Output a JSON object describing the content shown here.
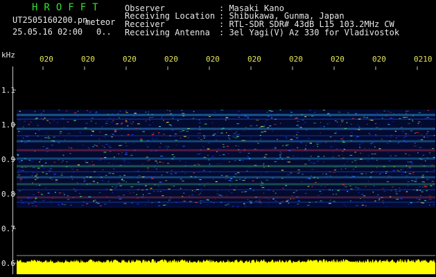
{
  "header": {
    "brand": "HROFFT",
    "filename": "UT2505160200.pn",
    "mode": "meteor",
    "datetime": "25.05.16 02:00",
    "extra": "0.."
  },
  "meta": {
    "observer_label": "Observer",
    "observer_value": ": Masaki Kano",
    "location_label": "Receiving Location",
    "location_value": ": Shibukawa, Gunma, Japan",
    "receiver_label": "Receiver",
    "receiver_value": ": RTL-SDR SDR# 43dB L15 103.2MHz CW",
    "antenna_label": "Receiving Antenna",
    "antenna_value": ": 3el Yagi(V) Az 330 for Vladivostok"
  },
  "axis": {
    "unit": "kHz",
    "y_ticks": [
      "1.1",
      "1.0",
      "0.9",
      "0.8",
      "0.7",
      "0.6"
    ],
    "x_ticks": [
      "020",
      "020",
      "020",
      "020",
      "020",
      "020",
      "020",
      "020",
      "020",
      "0210"
    ]
  },
  "colors": {
    "axis_text": "#e8e8e8",
    "time_text": "#e8e85a",
    "brand": "#2ee62e",
    "noise_band": "#ffff00"
  }
}
